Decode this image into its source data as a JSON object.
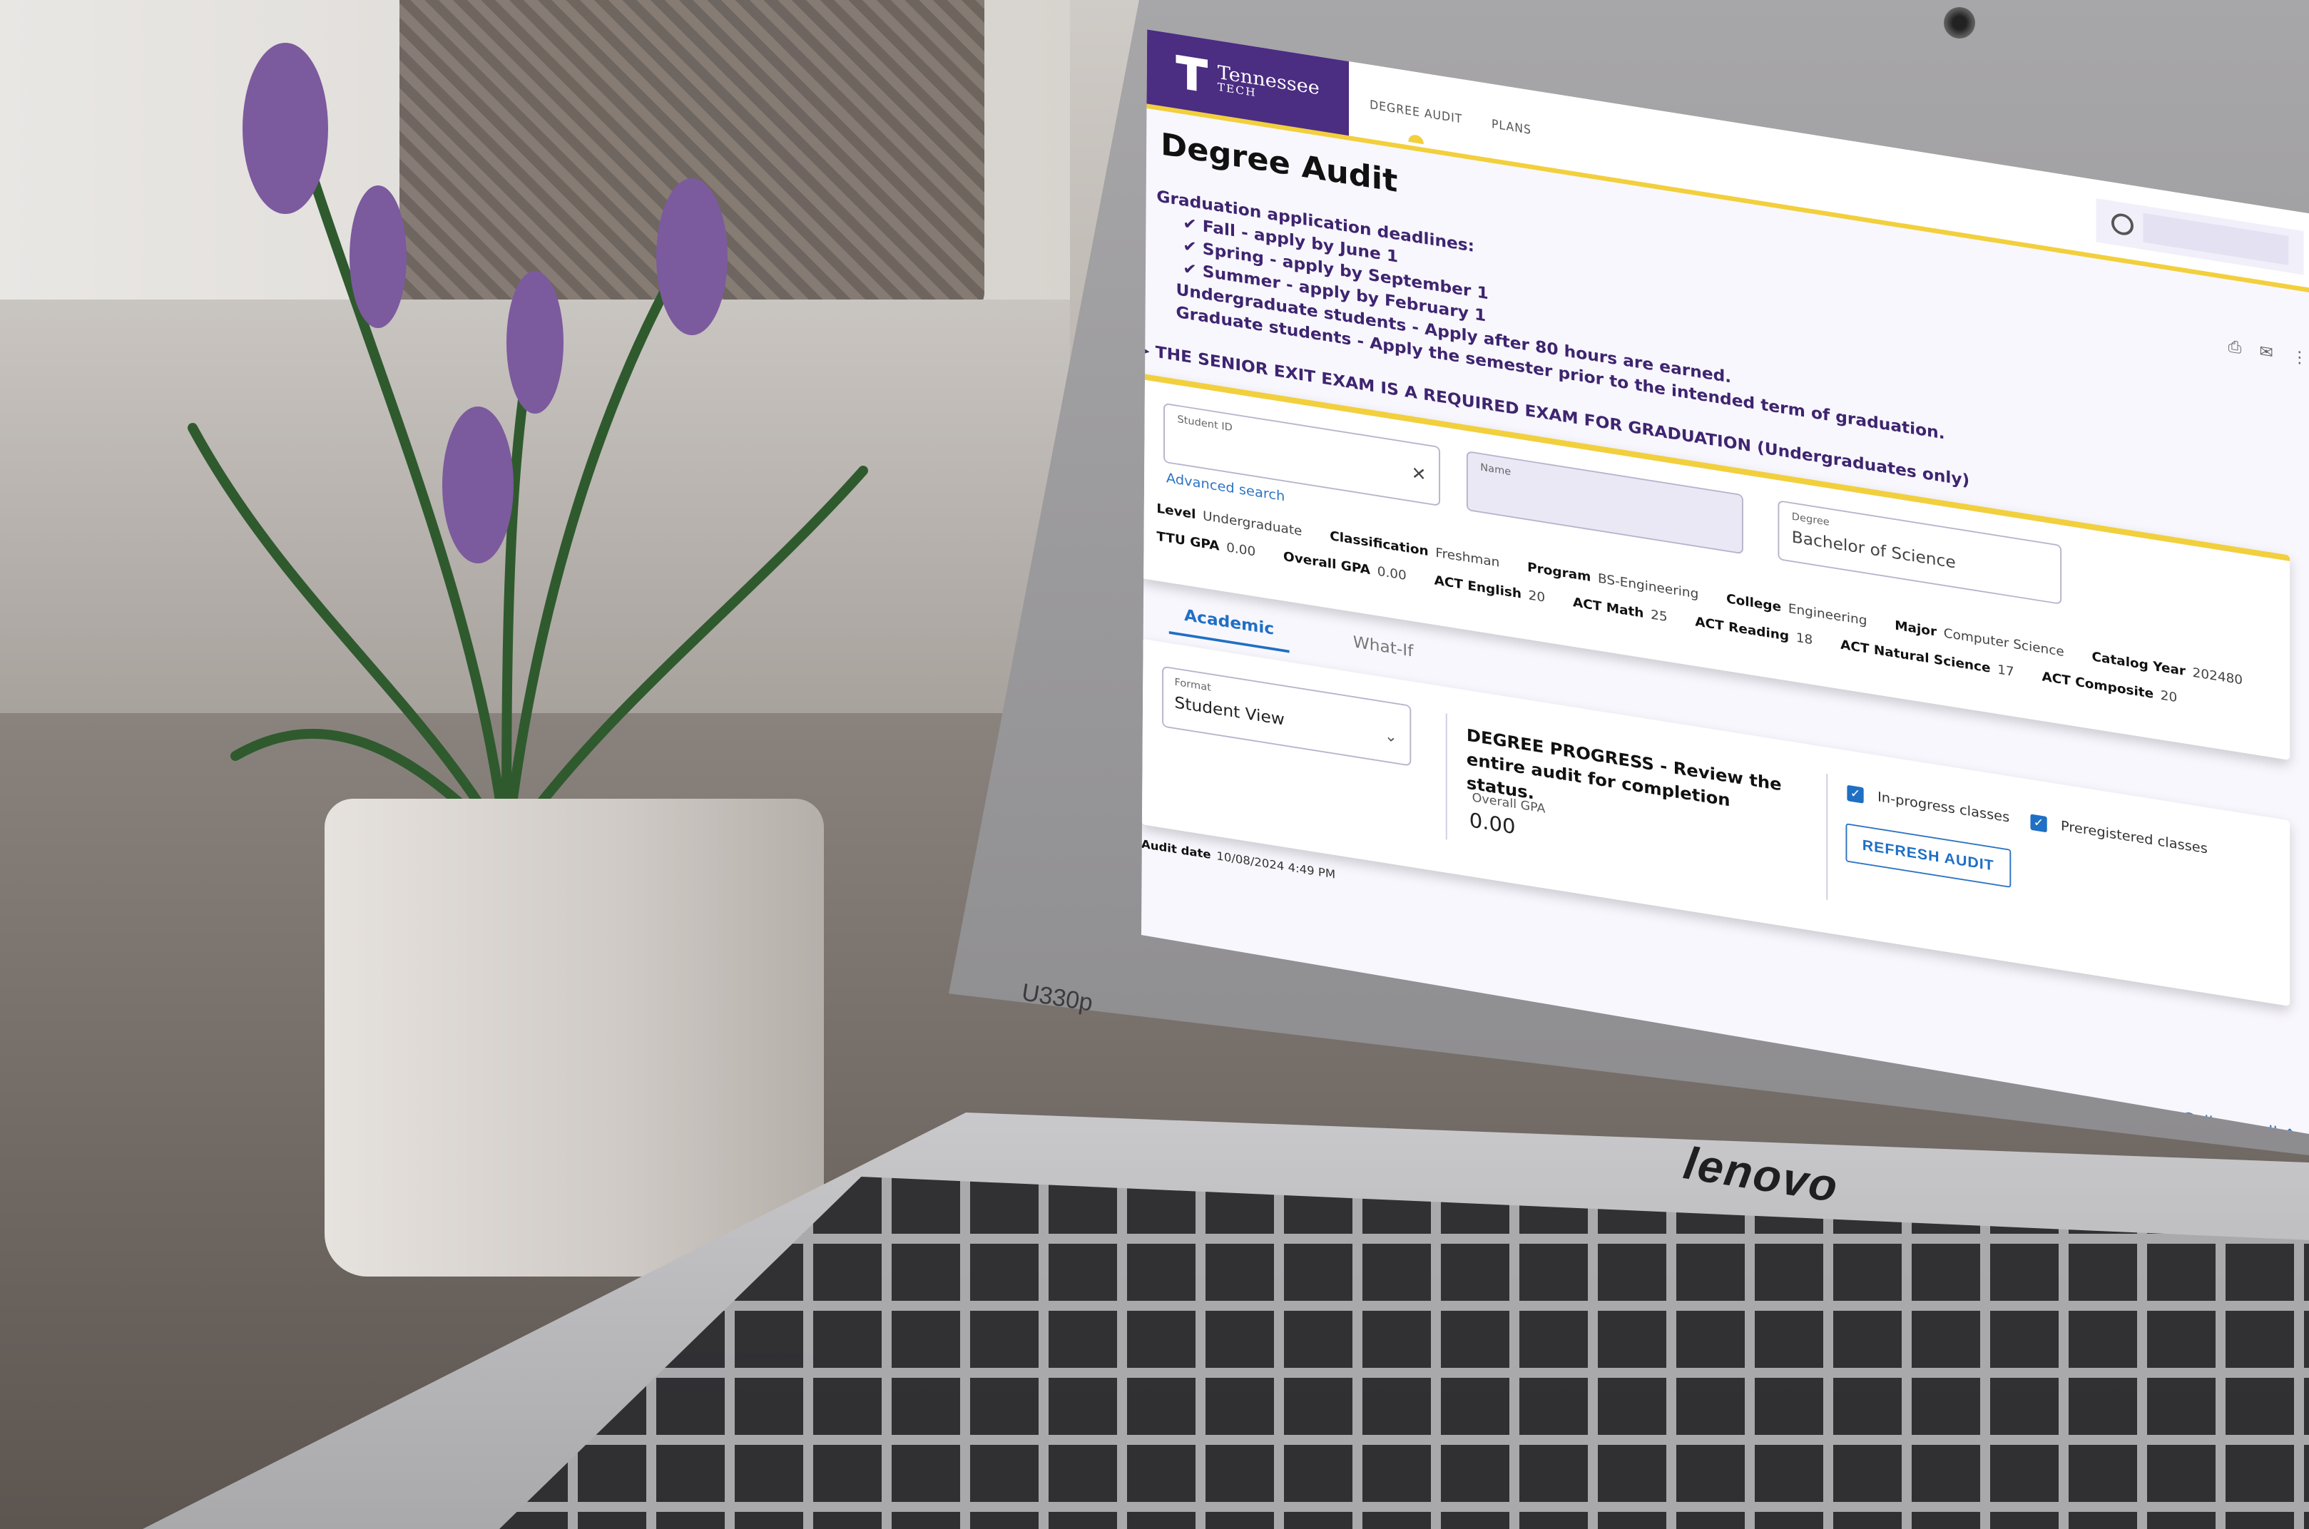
{
  "app": {
    "logo": {
      "line1": "Tennessee",
      "line2": "TECH"
    },
    "nav": [
      {
        "label": "DEGREE AUDIT",
        "active": true
      },
      {
        "label": "PLANS",
        "active": false
      }
    ],
    "user_icon": "user-circle-icon"
  },
  "page": {
    "title": "Degree Audit",
    "actions": [
      {
        "name": "print",
        "icon": "printer-icon",
        "glyph": "⎙"
      },
      {
        "name": "email",
        "icon": "envelope-icon",
        "glyph": "✉"
      },
      {
        "name": "more",
        "icon": "kebab-menu-icon",
        "glyph": "⋮"
      }
    ]
  },
  "notice": {
    "heading": "Graduation application deadlines:",
    "deadlines": [
      "✔ Fall - apply by June 1",
      "✔ Spring - apply by September 1",
      "✔ Summer - apply by February 1"
    ],
    "rules": [
      "Undergraduate students - Apply after 80 hours are earned.",
      "Graduate students - Apply the semester prior to the intended term of graduation."
    ],
    "senior_exit": "▸ THE SENIOR EXIT EXAM IS A REQUIRED EXAM FOR GRADUATION (Undergraduates only)"
  },
  "student": {
    "student_id": {
      "label": "Student ID",
      "value": ""
    },
    "advanced_search": "Advanced search",
    "name": {
      "label": "Name",
      "value": ""
    },
    "degree": {
      "label": "Degree",
      "value": "Bachelor of Science"
    },
    "info_row1": [
      {
        "label": "Level",
        "value": "Undergraduate"
      },
      {
        "label": "Classification",
        "value": "Freshman"
      },
      {
        "label": "Program",
        "value": "BS-Engineering"
      },
      {
        "label": "College",
        "value": "Engineering"
      },
      {
        "label": "Major",
        "value": "Computer Science"
      },
      {
        "label": "Catalog Year",
        "value": "202480"
      }
    ],
    "info_row2": [
      {
        "label": "TTU GPA",
        "value": "0.00"
      },
      {
        "label": "Overall GPA",
        "value": "0.00"
      },
      {
        "label": "ACT English",
        "value": "20"
      },
      {
        "label": "ACT Math",
        "value": "25"
      },
      {
        "label": "ACT Reading",
        "value": "18"
      },
      {
        "label": "ACT Natural Science",
        "value": "17"
      },
      {
        "label": "ACT Composite",
        "value": "20"
      }
    ]
  },
  "tabs": [
    {
      "label": "Academic",
      "active": true
    },
    {
      "label": "What-If",
      "active": false
    }
  ],
  "audit": {
    "format": {
      "label": "Format",
      "value": "Student View"
    },
    "progress_title": "DEGREE PROGRESS - Review the entire audit for completion status.",
    "overall_gpa_label": "Overall GPA",
    "overall_gpa_value": "0.00",
    "checkboxes": [
      {
        "label": "In-progress classes",
        "checked": true
      },
      {
        "label": "Preregistered classes",
        "checked": true
      }
    ],
    "refresh_button": "REFRESH AUDIT",
    "audit_date_label": "Audit date",
    "audit_date_value": "10/08/2024 4:49 PM",
    "collapse_all": "Collapse all ⌃"
  },
  "device": {
    "model_label": "U330p",
    "brand": "lenovo"
  },
  "colors": {
    "brand_purple": "#4b2d82",
    "accent_gold": "#f2cf3c",
    "link_blue": "#1f6fc4",
    "notice_purple": "#3e2470"
  }
}
